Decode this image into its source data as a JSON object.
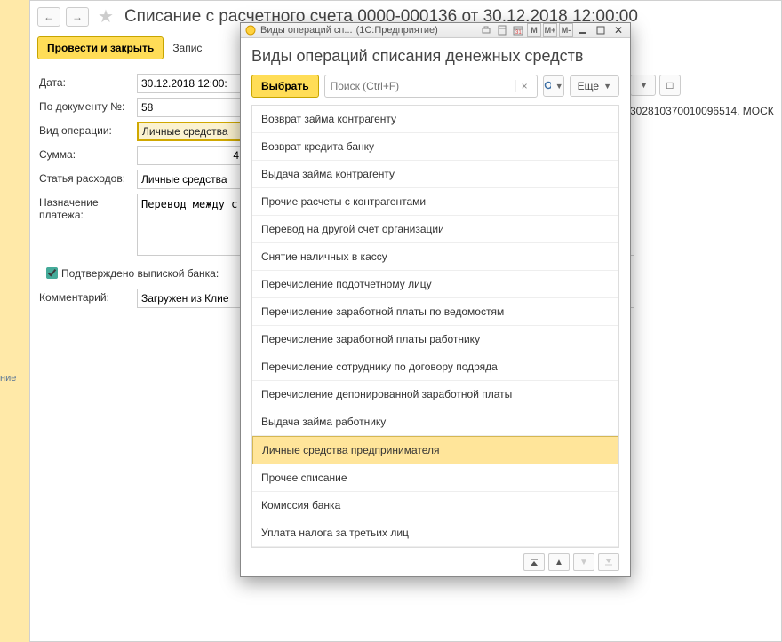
{
  "main": {
    "title": "Списание с расчетного счета 0000-000136 от 30.12.2018 12:00:00",
    "toolbar": {
      "post_close": "Провести и закрыть",
      "record": "Запис"
    },
    "left_edge_text": "ние"
  },
  "form": {
    "labels": {
      "date": "Дата:",
      "docnum": "По документу №:",
      "optype": "Вид операции:",
      "sum": "Сумма:",
      "expcat": "Статья расходов:",
      "purpose": "Назначение платежа:",
      "confirmed": "Подтверждено выпиской банка:",
      "comment": "Комментарий:"
    },
    "values": {
      "date": "30.12.2018 12:00:",
      "docnum": "58",
      "optype": "Личные средства",
      "sum": "4",
      "expcat": "Личные средства",
      "purpose": "Перевод между с",
      "comment": "Загружен из Клие"
    },
    "right_fragment": {
      "account": "30281037001009​6514, МОСК"
    }
  },
  "popup": {
    "titlebar": {
      "short_title": "Виды операций сп...",
      "app": "(1С:Предприятие)",
      "m": "M",
      "mplus": "M+",
      "mminus": "M-"
    },
    "heading": "Виды операций списания денежных средств",
    "buttons": {
      "choose": "Выбрать",
      "more": "Еще"
    },
    "search_placeholder": "Поиск (Ctrl+F)",
    "items": [
      "Возврат займа контрагенту",
      "Возврат кредита банку",
      "Выдача займа контрагенту",
      "Прочие расчеты с контрагентами",
      "Перевод на другой счет организации",
      "Снятие наличных в кассу",
      "Перечисление подотчетному лицу",
      "Перечисление заработной платы по ведомостям",
      "Перечисление заработной платы работнику",
      "Перечисление сотруднику по договору подряда",
      "Перечисление депонированной заработной платы",
      "Выдача займа работнику",
      "Личные средства предпринимателя",
      "Прочее списание",
      "Комиссия банка",
      "Уплата налога за третьих лиц"
    ],
    "selected_index": 12
  }
}
